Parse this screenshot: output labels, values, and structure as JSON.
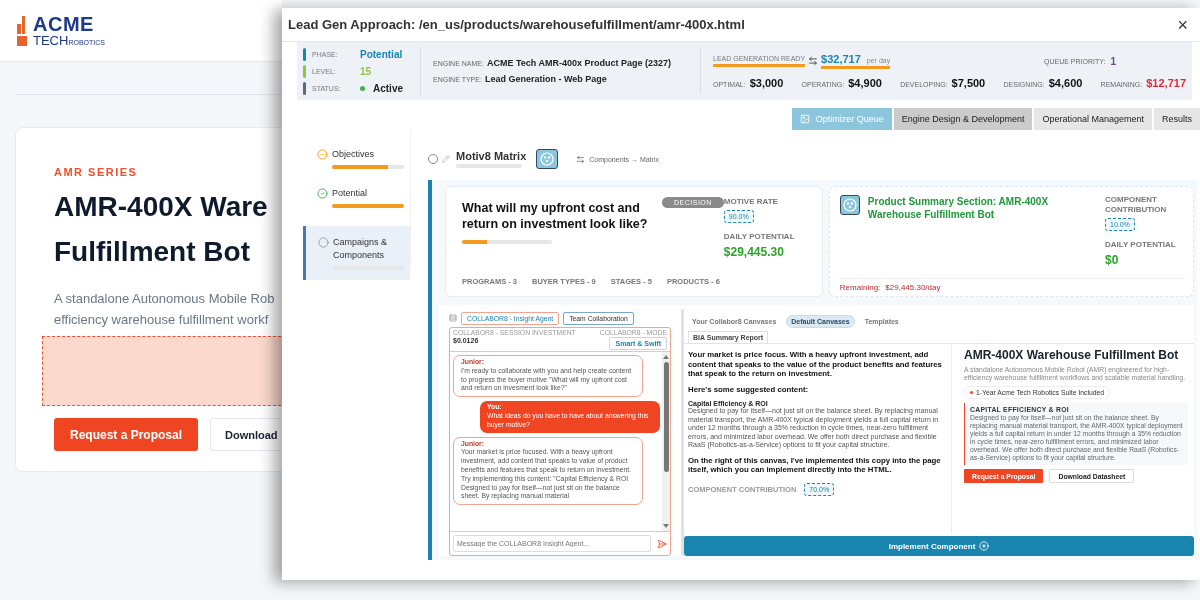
{
  "page": {
    "logo": {
      "name": "ACME",
      "sub": "TECH",
      "tag": "ROBOTICS"
    },
    "eyebrow": "AMR SERIES",
    "title_lines": [
      "AMR-400X Ware",
      "Fulfillment Bot"
    ],
    "description_lines": [
      "A standalone Autonomous Mobile Rob",
      "efficiency warehouse fulfillment workf"
    ],
    "buttons": [
      {
        "label": "Request a Proposal",
        "kind": "primary"
      },
      {
        "label": "Download",
        "kind": "secondary"
      }
    ]
  },
  "dialog": {
    "title": "Lead Gen Approach: /en_us/products/warehousefulfillment/amr-400x.html",
    "close": "×",
    "info": {
      "rows": [
        {
          "label": "PHASE:",
          "value": "Potential",
          "color": "#1a86b0",
          "kind": "text"
        },
        {
          "label": "LEVEL:",
          "value": "15",
          "color": "#8cc63f",
          "kind": "text"
        },
        {
          "label": "STATUS:",
          "value": "Active",
          "color": "#5a6b80",
          "kind": "status"
        }
      ],
      "engine": [
        {
          "label": "ENGINE NAME:",
          "value": "ACME Tech AMR-400x Product Page (2327)"
        },
        {
          "label": "ENGINE TYPE:",
          "value": "Lead Generation - Web Page"
        }
      ],
      "lead": {
        "label": "LEAD GENERATION READY",
        "value": "$32,717",
        "unit": "per day",
        "priority_label": "QUEUE PRIORITY:",
        "priority": "1"
      },
      "metrics": [
        {
          "label": "OPTIMAL:",
          "value": "$3,000",
          "kind": "normal"
        },
        {
          "label": "OPERATING:",
          "value": "$4,900",
          "kind": "normal"
        },
        {
          "label": "DEVELOPING:",
          "value": "$7,500",
          "kind": "normal"
        },
        {
          "label": "DESIGNING:",
          "value": "$4,600",
          "kind": "normal"
        },
        {
          "label": "REMAINING:",
          "value": "$12,717",
          "kind": "alert"
        }
      ]
    },
    "tabs": [
      {
        "label": "Optimizer Queue",
        "selected": true,
        "hovered": false
      },
      {
        "label": "Engine Design & Development",
        "selected": false,
        "hovered": true
      },
      {
        "label": "Operational Management",
        "selected": false,
        "hovered": false
      },
      {
        "label": "Results",
        "selected": false,
        "hovered": false
      }
    ],
    "sidebar": [
      {
        "label": "Objectives",
        "kind": "partial",
        "level": 0.78,
        "selected": false
      },
      {
        "label": "Potential",
        "kind": "done",
        "level": 1,
        "selected": false
      },
      {
        "label": "Campaigns & Components",
        "kind": "empty",
        "level": 0,
        "selected": true
      }
    ],
    "matrix": {
      "title": "Motiv8 Matrix",
      "checked": false,
      "link": "Components → Matrix"
    },
    "motive": {
      "question": "What will my upfront cost and return on investment look like?",
      "badge": "DECISION",
      "level": 0.28,
      "stats": [
        "PROGRAMS - 3",
        "BUYER TYPES - 9",
        "STAGES - 5",
        "PRODUCTS - 6"
      ],
      "rate_label": "MOTIVE RATE",
      "rate": "90.0%",
      "potential_label": "DAILY POTENTIAL",
      "potential": "$29,445.30"
    },
    "component": {
      "title": "Product Summary Section: AMR-400X Warehouse Fulfillment Bot",
      "contribution_label": "COMPONENT CONTRIBUTION",
      "contribution": "10.0%",
      "potential_label": "DAILY POTENTIAL",
      "potential": "$0",
      "remaining_label": "Remaining:",
      "remaining": "$29,445.30/day"
    },
    "chat": {
      "tabs": [
        {
          "label": "COLLABOR8 - Insight Agent",
          "selected": true
        },
        {
          "label": "Team Collaboration",
          "selected": false
        }
      ],
      "investment_label": "COLLABOR8 - SESSION INVESTMENT",
      "investment": "$0.0126",
      "mode_label": "COLLABOR8 - MODE",
      "mode": "Smart & Swift",
      "messages": [
        {
          "author": "Junior:",
          "kind": "agent",
          "text": "I'm ready to collaborate with you and help create content to progress the buyer motive \"What will my upfront cost and return on invesment look like?\""
        },
        {
          "author": "You:",
          "kind": "user",
          "text": "What ideas do you have to have about answering this buyer motive?"
        },
        {
          "author": "Junior:",
          "kind": "agent",
          "text": "Your market is price focused. With a heavy upfront investment, add content that speaks to value of product benefits and features that speak to return on investment. Try implementing this content: \"Capital Efficiency & ROI Designed to pay for itself—not just sit on the balance sheet. By replacing manual material"
        }
      ],
      "placeholder": "Message the COLLABOR8 Insight Agent..."
    },
    "canvas": {
      "tabs": [
        {
          "label": "Your Collabor8 Canvases",
          "selected": false
        },
        {
          "label": "Default Canvases",
          "selected": true
        },
        {
          "label": "Templates",
          "selected": false
        }
      ],
      "subtab": "BIA Summary Report",
      "intro": "Your market is price focus. With a heavy upfront investment, add content that speaks to the value of the product benefits and features that speak to the return on investment.",
      "suggest_heading": "Here's some suggested content:",
      "content_title": "Capital Efficiency & ROI",
      "content_body": "Designed to pay for itself—not just sit on the balance sheet. By replacing manual material transport, the AMR-400X typical deployment yields a full capital return in under 12 months through a 35% reduction in cycle times, near-zero fulfillment errors, and minimized labor overhead. We offer both direct purchase and flexible RaaS (Robotics-as-a-Service) options to fit your capital structure.",
      "closing": "On the right of this canvas, I've implemented this copy into the page itself, which you can implement directly into the HTML.",
      "contribution_label": "COMPONENT CONTRIBUTION",
      "contribution": "70.0%",
      "action": "Implement Component",
      "preview": {
        "title": "AMR-400X Warehouse Fulfillment Bot",
        "description": "A standalone Autonomous Mobile Robot (AMR) engineered for high-efficiency warehouse fulfillment workflows and scalable material handling.",
        "badge": "1-Year Acme Tech Robotics Suite Included",
        "callout_title": "CAPITAL EFFICIENCY & ROI",
        "callout_body": "Designed to pay for itself—not just sit on the balance sheet. By replacing manual material transport, the AMR-400X typical deployment yields a full capital return in under 12 months through a 35% reduction in cycle times, near-zero fulfillment errors, and minimized labor overhead. We offer both direct purchase and flexible RaaS (Robotics-as-a-Service) options to fit your capital structure.",
        "buttons": [
          {
            "label": "Request a Proposal",
            "kind": "primary"
          },
          {
            "label": "Download Datasheet",
            "kind": "secondary"
          }
        ]
      }
    }
  }
}
